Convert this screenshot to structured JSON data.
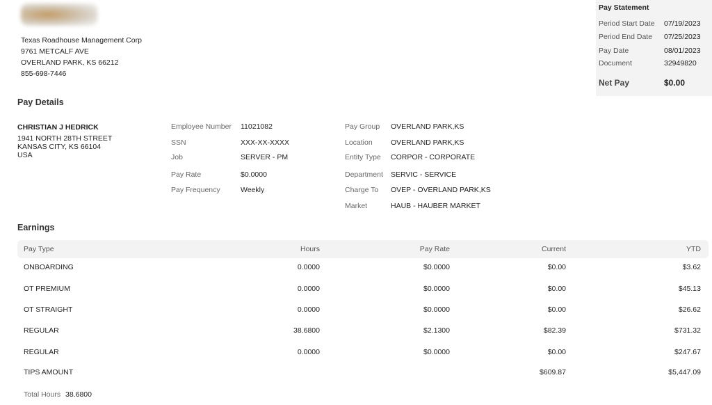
{
  "company": {
    "name": "Texas Roadhouse Management Corp",
    "address1": "9761 METCALF AVE",
    "address2": "OVERLAND PARK, KS 66212",
    "phone": "855-698-7446"
  },
  "pay_statement": {
    "title": "Pay Statement",
    "rows": [
      {
        "label": "Period Start Date",
        "value": "07/19/2023"
      },
      {
        "label": "Period End Date",
        "value": "07/25/2023"
      },
      {
        "label": "Pay Date",
        "value": "08/01/2023"
      },
      {
        "label": "Document",
        "value": "32949820"
      }
    ],
    "net_pay_label": "Net Pay",
    "net_pay_value": "$0.00"
  },
  "pay_details": {
    "title": "Pay Details",
    "employee": {
      "name": "CHRISTIAN J HEDRICK",
      "address1": "1941 NORTH 28TH STREET",
      "address2": "KANSAS CITY, KS 66104",
      "country": "USA"
    },
    "col1": [
      {
        "label": "Employee Number",
        "value": "11021082"
      },
      {
        "label": "SSN",
        "value": "XXX-XX-XXXX"
      },
      {
        "label": "Job",
        "value": "SERVER - PM"
      },
      {
        "label": "Pay Rate",
        "value": "$0.0000"
      },
      {
        "label": "Pay Frequency",
        "value": "Weekly"
      }
    ],
    "col2": [
      {
        "label": "Pay Group",
        "value": "OVERLAND PARK,KS"
      },
      {
        "label": "Location",
        "value": "OVERLAND PARK,KS"
      },
      {
        "label": "Entity Type",
        "value": "CORPOR - CORPORATE"
      },
      {
        "label": "Department",
        "value": "SERVIC - SERVICE"
      },
      {
        "label": "Charge To",
        "value": "OVEP - OVERLAND PARK,KS"
      },
      {
        "label": "Market",
        "value": "HAUB - HAUBER MARKET"
      }
    ]
  },
  "earnings": {
    "title": "Earnings",
    "headers": {
      "pay_type": "Pay Type",
      "hours": "Hours",
      "pay_rate": "Pay Rate",
      "current": "Current",
      "ytd": "YTD"
    },
    "rows": [
      {
        "pay_type": "ONBOARDING",
        "hours": "0.0000",
        "pay_rate": "$0.0000",
        "current": "$0.00",
        "ytd": "$3.62"
      },
      {
        "pay_type": "OT PREMIUM",
        "hours": "0.0000",
        "pay_rate": "$0.0000",
        "current": "$0.00",
        "ytd": "$45.13"
      },
      {
        "pay_type": "OT STRAIGHT",
        "hours": "0.0000",
        "pay_rate": "$0.0000",
        "current": "$0.00",
        "ytd": "$26.62"
      },
      {
        "pay_type": "REGULAR",
        "hours": "38.6800",
        "pay_rate": "$2.1300",
        "current": "$82.39",
        "ytd": "$731.32"
      },
      {
        "pay_type": "REGULAR",
        "hours": "0.0000",
        "pay_rate": "$0.0000",
        "current": "$0.00",
        "ytd": "$247.67"
      },
      {
        "pay_type": "TIPS AMOUNT",
        "hours": "",
        "pay_rate": "",
        "current": "$609.87",
        "ytd": "$5,447.09"
      }
    ],
    "total_hours_label": "Total Hours",
    "total_hours_value": "38.6800"
  }
}
